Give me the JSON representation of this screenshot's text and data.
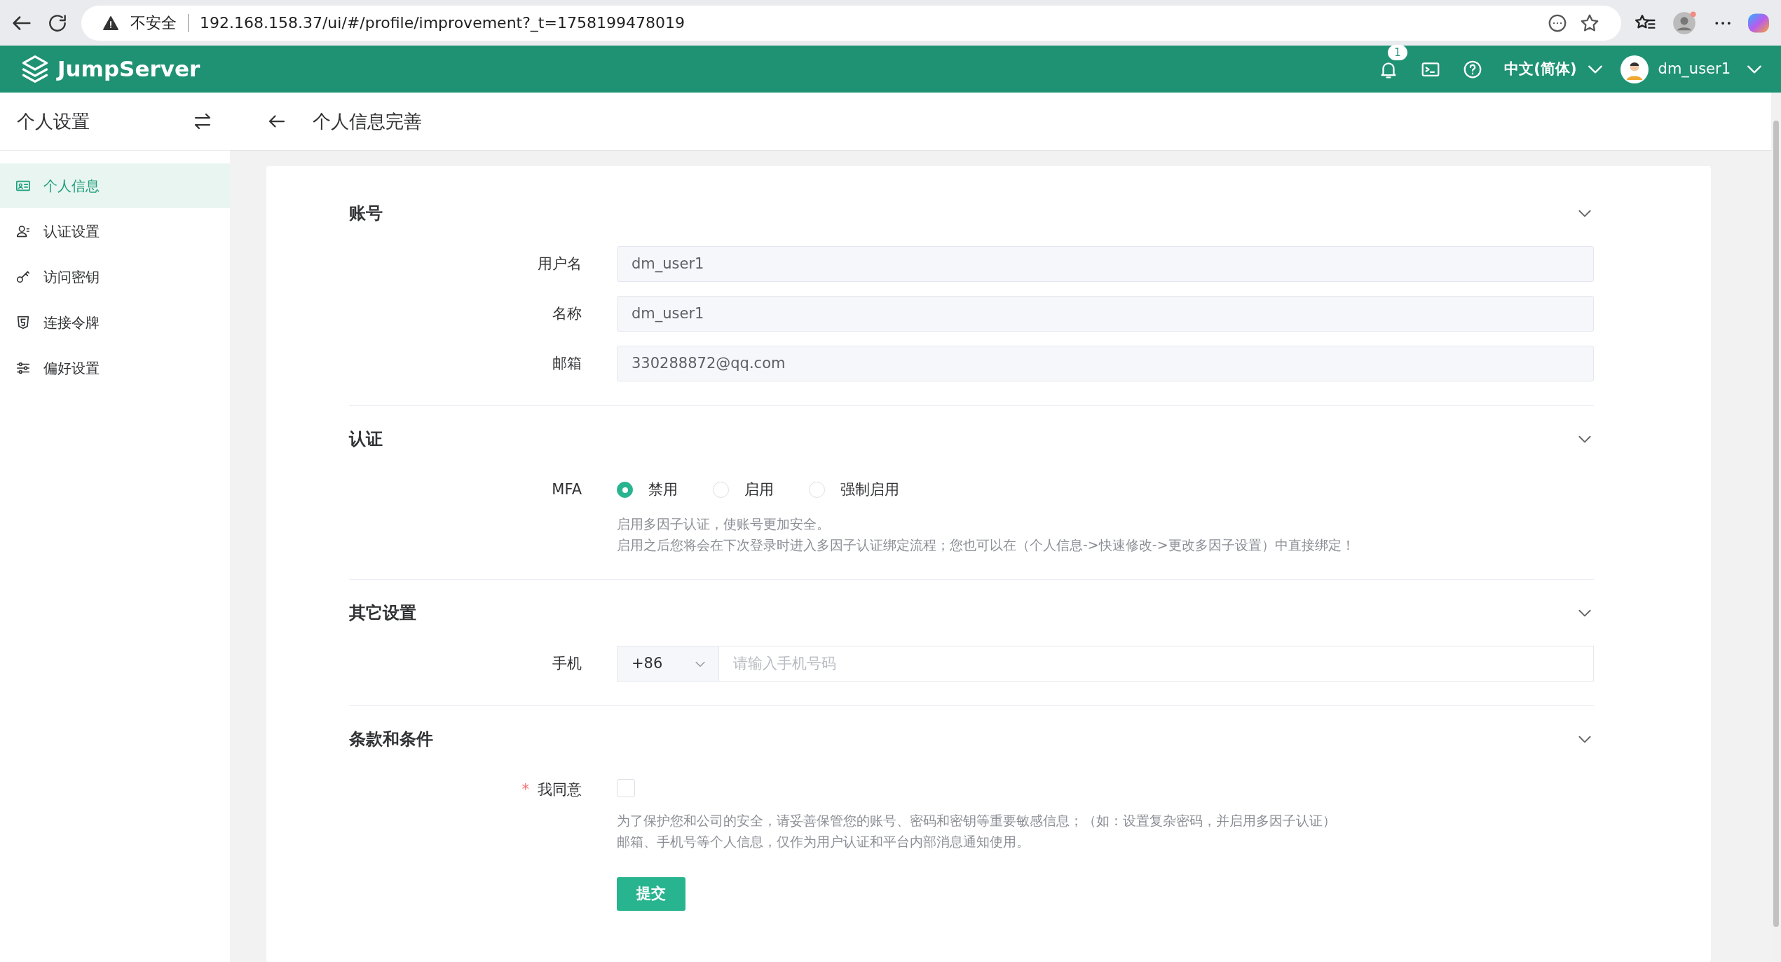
{
  "browser": {
    "security": "不安全",
    "url": "192.168.158.37/ui/#/profile/improvement?_t=1758199478019"
  },
  "header": {
    "brand": "JumpServer",
    "notification_count": "1",
    "language": "中文(简体)",
    "user": "dm_user1"
  },
  "sidebar": {
    "title": "个人设置",
    "items": [
      {
        "label": "个人信息",
        "selected": true
      },
      {
        "label": "认证设置",
        "selected": false
      },
      {
        "label": "访问密钥",
        "selected": false
      },
      {
        "label": "连接令牌",
        "selected": false
      },
      {
        "label": "偏好设置",
        "selected": false
      }
    ]
  },
  "page": {
    "title": "个人信息完善"
  },
  "sections": [
    {
      "title": "账号",
      "expanded": true,
      "fields": [
        {
          "kind": "input",
          "label": "用户名",
          "value": "dm_user1"
        },
        {
          "kind": "input",
          "label": "名称",
          "value": "dm_user1"
        },
        {
          "kind": "input",
          "label": "邮箱",
          "value": "330288872@qq.com"
        }
      ]
    },
    {
      "title": "认证",
      "expanded": true,
      "fields": [
        {
          "kind": "radio",
          "label": "MFA",
          "options": [
            {
              "label": "禁用",
              "selected": true
            },
            {
              "label": "启用",
              "selected": false
            },
            {
              "label": "强制启用",
              "selected": false
            }
          ],
          "help": [
            "启用多因子认证，使账号更加安全。",
            "启用之后您将会在下次登录时进入多因子认证绑定流程；您也可以在（个人信息->快速修改->更改多因子设置）中直接绑定！"
          ]
        }
      ]
    },
    {
      "title": "其它设置",
      "expanded": true,
      "fields": [
        {
          "kind": "phone",
          "label": "手机",
          "code": "+86",
          "placeholder": "请输入手机号码"
        }
      ]
    },
    {
      "title": "条款和条件",
      "expanded": true,
      "fields": [
        {
          "kind": "checkbox",
          "label": "我同意",
          "required_mark": "*",
          "checked": false,
          "help": [
            "为了保护您和公司的安全，请妥善保管您的账号、密码和密钥等重要敏感信息；（如：设置复杂密码，并启用多因子认证）",
            "邮箱、手机号等个人信息，仅作为用户认证和平台内部消息通知使用。"
          ]
        }
      ]
    }
  ],
  "submit": "提交"
}
